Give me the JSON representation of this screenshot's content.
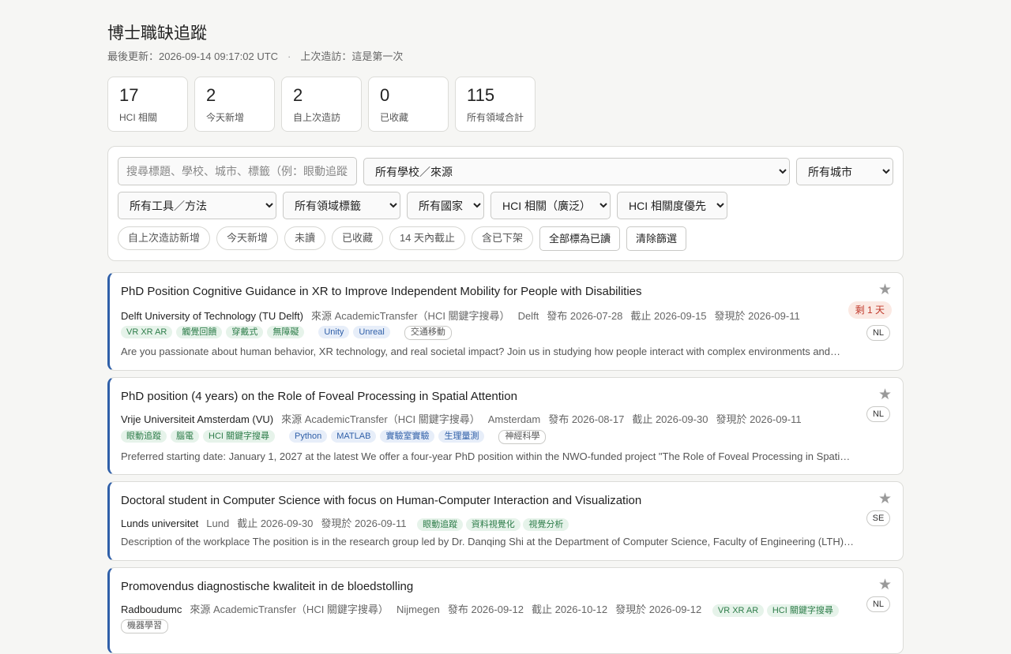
{
  "header": {
    "title": "博士職缺追蹤",
    "last_updated": "最後更新：2026-09-14 09:17:02 UTC",
    "separator": "·",
    "last_visit": "上次造訪：這是第一次"
  },
  "stats": [
    {
      "value": "17",
      "label": "HCI 相關"
    },
    {
      "value": "2",
      "label": "今天新增"
    },
    {
      "value": "2",
      "label": "自上次造訪"
    },
    {
      "value": "0",
      "label": "已收藏"
    },
    {
      "value": "115",
      "label": "所有領域合計"
    }
  ],
  "filters": {
    "search_placeholder": "搜尋標題、學校、城市、標籤（例：眼動追蹤",
    "school_select": "所有學校／來源",
    "city_select": "所有城市",
    "tools_select": "所有工具／方法",
    "field_select": "所有領域標籤",
    "country_select": "所有國家",
    "hci_select": "HCI 相關（廣泛）",
    "sort_select": "HCI 相關度優先",
    "chips": [
      "自上次造訪新增",
      "今天新增",
      "未讀",
      "已收藏",
      "14 天內截止",
      "含已下架"
    ],
    "mark_all_read": "全部標為已讀",
    "clear_filters": "清除篩選"
  },
  "jobs": [
    {
      "title": "PhD Position Cognitive Guidance in XR to Improve Independent Mobility for People with Disabilities",
      "org": "Delft University of Technology (TU Delft)",
      "source": "來源 AcademicTransfer（HCI 關鍵字搜尋）",
      "city": "Delft",
      "posted": "發布 2026-07-28",
      "deadline": "截止 2026-09-15",
      "found": "發現於 2026-09-11",
      "tags_green": [
        "VR XR AR",
        "觸覺回饋",
        "穿戴式",
        "無障礙"
      ],
      "tags_blue": [
        "Unity",
        "Unreal"
      ],
      "tags_outline": [
        "交通移動"
      ],
      "desc": "Are you passionate about human behavior, XR technology, and real societal impact? Join us in studying how people interact with complex environments and…",
      "days_left": "剩 1 天",
      "country": "NL",
      "star": "★"
    },
    {
      "title": "PhD position (4 years) on the Role of Foveal Processing in Spatial Attention",
      "org": "Vrije Universiteit Amsterdam (VU)",
      "source": "來源 AcademicTransfer（HCI 關鍵字搜尋）",
      "city": "Amsterdam",
      "posted": "發布 2026-08-17",
      "deadline": "截止 2026-09-30",
      "found": "發現於 2026-09-11",
      "tags_green": [
        "眼動追蹤",
        "腦電",
        "HCI 關鍵字搜尋"
      ],
      "tags_blue": [
        "Python",
        "MATLAB",
        "實驗室實驗",
        "生理量測"
      ],
      "tags_outline": [
        "神經科學"
      ],
      "desc": "Preferred starting date: January 1, 2027 at the latest We offer a four-year PhD position within the NWO-funded project \"The Role of Foveal Processing in Spatial…",
      "country": "NL",
      "star": "★"
    },
    {
      "title": "Doctoral student in Computer Science with focus on Human-Computer Interaction and Visualization",
      "org": "Lunds universitet",
      "city": "Lund",
      "deadline": "截止 2026-09-30",
      "found": "發現於 2026-09-11",
      "tags_green": [
        "眼動追蹤",
        "資料視覺化",
        "視覺分析"
      ],
      "desc": "Description of the workplace The position is in the research group led by Dr. Danqing Shi at the Department of Computer Science, Faculty of Engineering (LTH),…",
      "country": "SE",
      "star": "★"
    },
    {
      "title": "Promovendus diagnostische kwaliteit in de bloedstolling",
      "org": "Radboudumc",
      "source": "來源 AcademicTransfer（HCI 關鍵字搜尋）",
      "city": "Nijmegen",
      "posted": "發布 2026-09-12",
      "deadline": "截止 2026-10-12",
      "found": "發現於 2026-09-12",
      "tags_green": [
        "VR XR AR",
        "HCI 關鍵字搜尋"
      ],
      "tags_outline": [
        "機器學習"
      ],
      "country": "NL",
      "star": "★"
    }
  ],
  "colors": {
    "accent": "#2f5fa8",
    "tag_green_bg": "#e6f3ea",
    "tag_green_fg": "#2e7d4a",
    "tag_blue_bg": "#e7eef9",
    "tag_blue_fg": "#2f5fa8",
    "deadline_badge_bg": "#fbe9e3",
    "deadline_badge_fg": "#c0392b"
  }
}
